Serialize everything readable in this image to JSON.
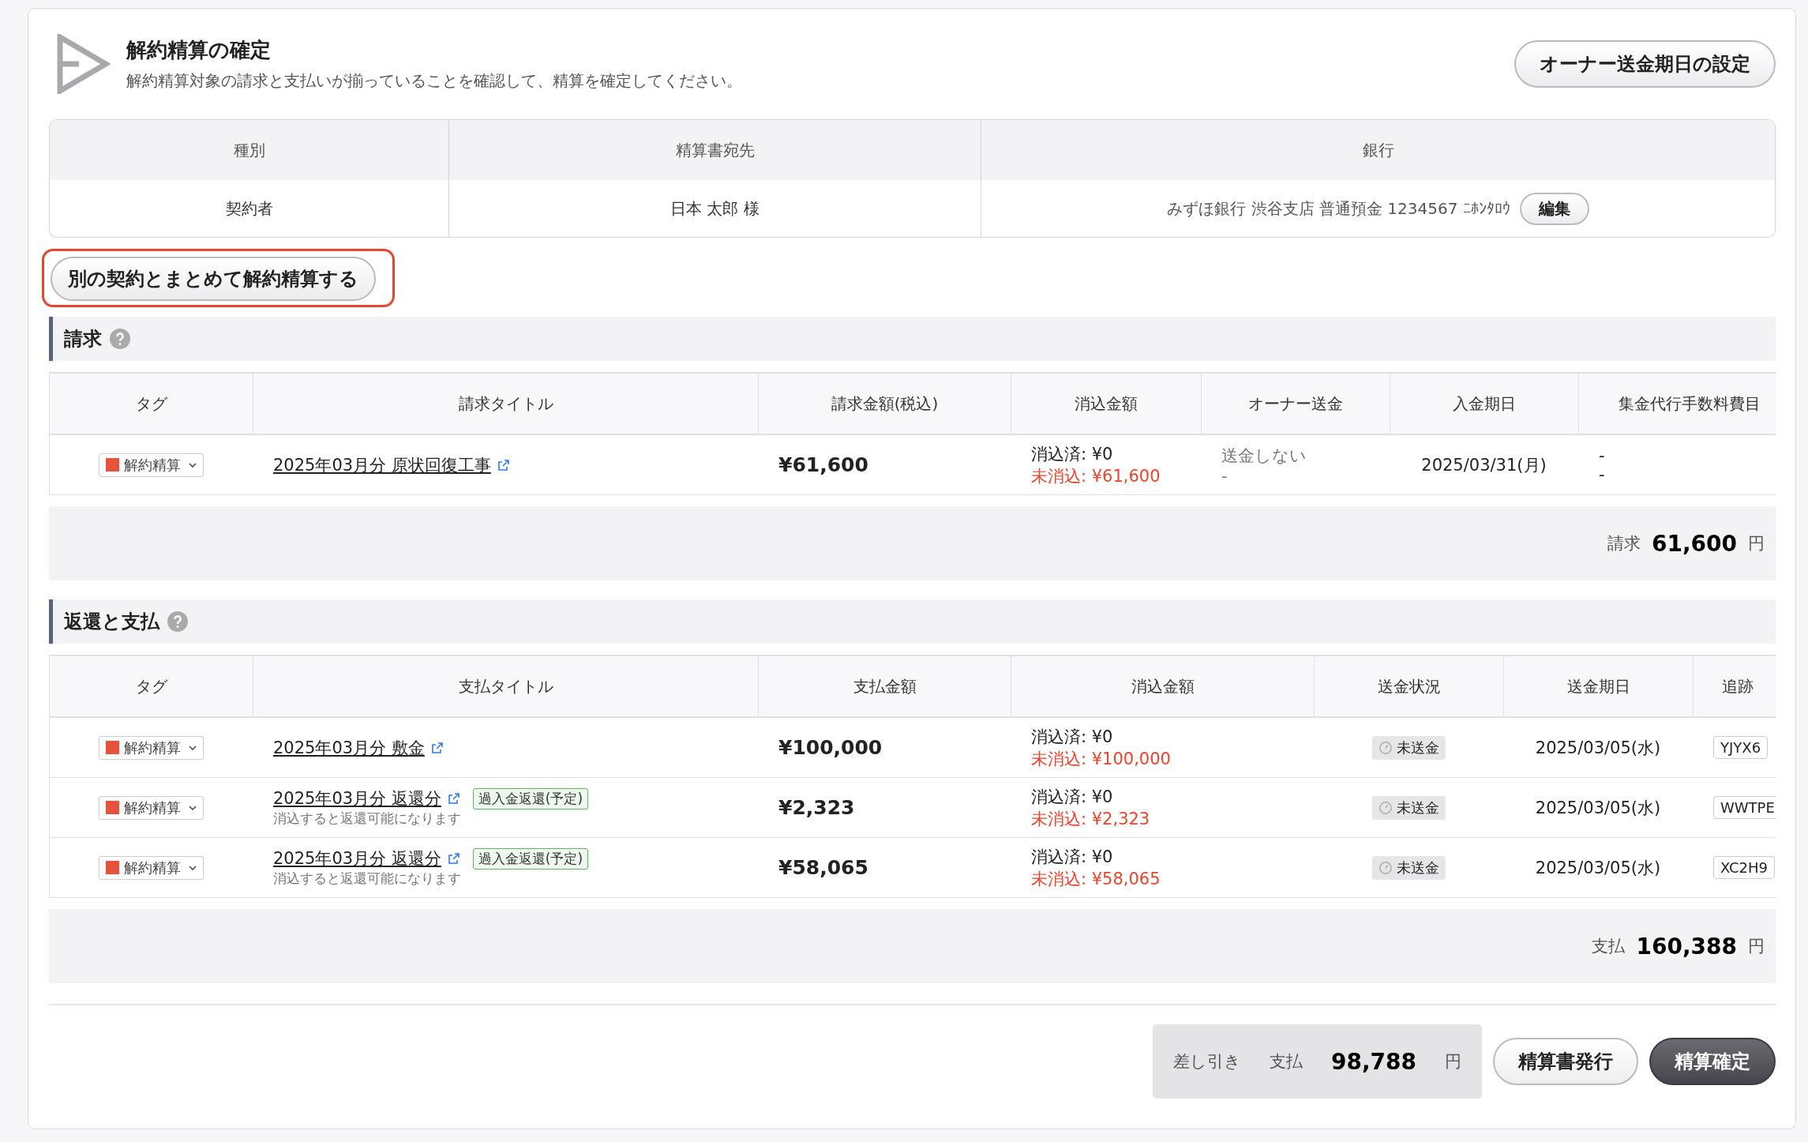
{
  "header": {
    "title": "解約精算の確定",
    "description": "解約精算対象の請求と支払いが揃っていることを確認して、精算を確定してください。",
    "button": "オーナー送金期日の設定"
  },
  "info": {
    "columns": [
      "種別",
      "精算書宛先",
      "銀行"
    ],
    "type": "契約者",
    "recipient": "日本 太郎 様",
    "bank": "みずほ銀行 渋谷支店 普通預金 1234567 ﾆﾎﾝﾀﾛｳ",
    "edit_button": "編集"
  },
  "merge_button": {
    "label": "別の契約とまとめて解約精算する",
    "highlighted": true
  },
  "billing": {
    "title": "請求",
    "columns": [
      "タグ",
      "請求タイトル",
      "請求金額(税込)",
      "消込金額",
      "オーナー送金",
      "入金期日",
      "集金代行手数料費目"
    ],
    "rows": [
      {
        "tag": "解約精算",
        "title": "2025年03月分 原状回復工事",
        "amount": "¥61,600",
        "cleared": "消込済: ¥0",
        "uncleared": "未消込: ¥61,600",
        "owner_remit": "送金しない",
        "owner_remit_sub": "-",
        "due_date": "2025/03/31(月)",
        "fee": "-",
        "fee_sub": "-"
      }
    ],
    "summary": {
      "label": "請求",
      "amount": "61,600",
      "unit": "円"
    }
  },
  "refunds": {
    "title": "返還と支払",
    "columns": [
      "タグ",
      "支払タイトル",
      "支払金額",
      "消込金額",
      "送金状況",
      "送金期日",
      "追跡"
    ],
    "rows": [
      {
        "tag": "解約精算",
        "title": "2025年03月分 敷金",
        "amount": "¥100,000",
        "cleared": "消込済: ¥0",
        "uncleared": "未消込: ¥100,000",
        "status": "未送金",
        "date": "2025/03/05(水)",
        "tracking": "YJYX6"
      },
      {
        "tag": "解約精算",
        "title": "2025年03月分 返還分",
        "badge": "過入金返還(予定)",
        "note": "消込すると返還可能になります",
        "amount": "¥2,323",
        "cleared": "消込済: ¥0",
        "uncleared": "未消込: ¥2,323",
        "status": "未送金",
        "date": "2025/03/05(水)",
        "tracking": "WWTPE"
      },
      {
        "tag": "解約精算",
        "title": "2025年03月分 返還分",
        "badge": "過入金返還(予定)",
        "note": "消込すると返還可能になります",
        "amount": "¥58,065",
        "cleared": "消込済: ¥0",
        "uncleared": "未消込: ¥58,065",
        "status": "未送金",
        "date": "2025/03/05(水)",
        "tracking": "XC2H9"
      }
    ],
    "summary": {
      "label": "支払",
      "amount": "160,388",
      "unit": "円"
    }
  },
  "footer": {
    "diff_label": "差し引き",
    "kind_label": "支払",
    "amount": "98,788",
    "unit": "円",
    "buttons": [
      {
        "label": "精算書発行",
        "kind": "secondary"
      },
      {
        "label": "精算確定",
        "kind": "primary"
      }
    ]
  }
}
